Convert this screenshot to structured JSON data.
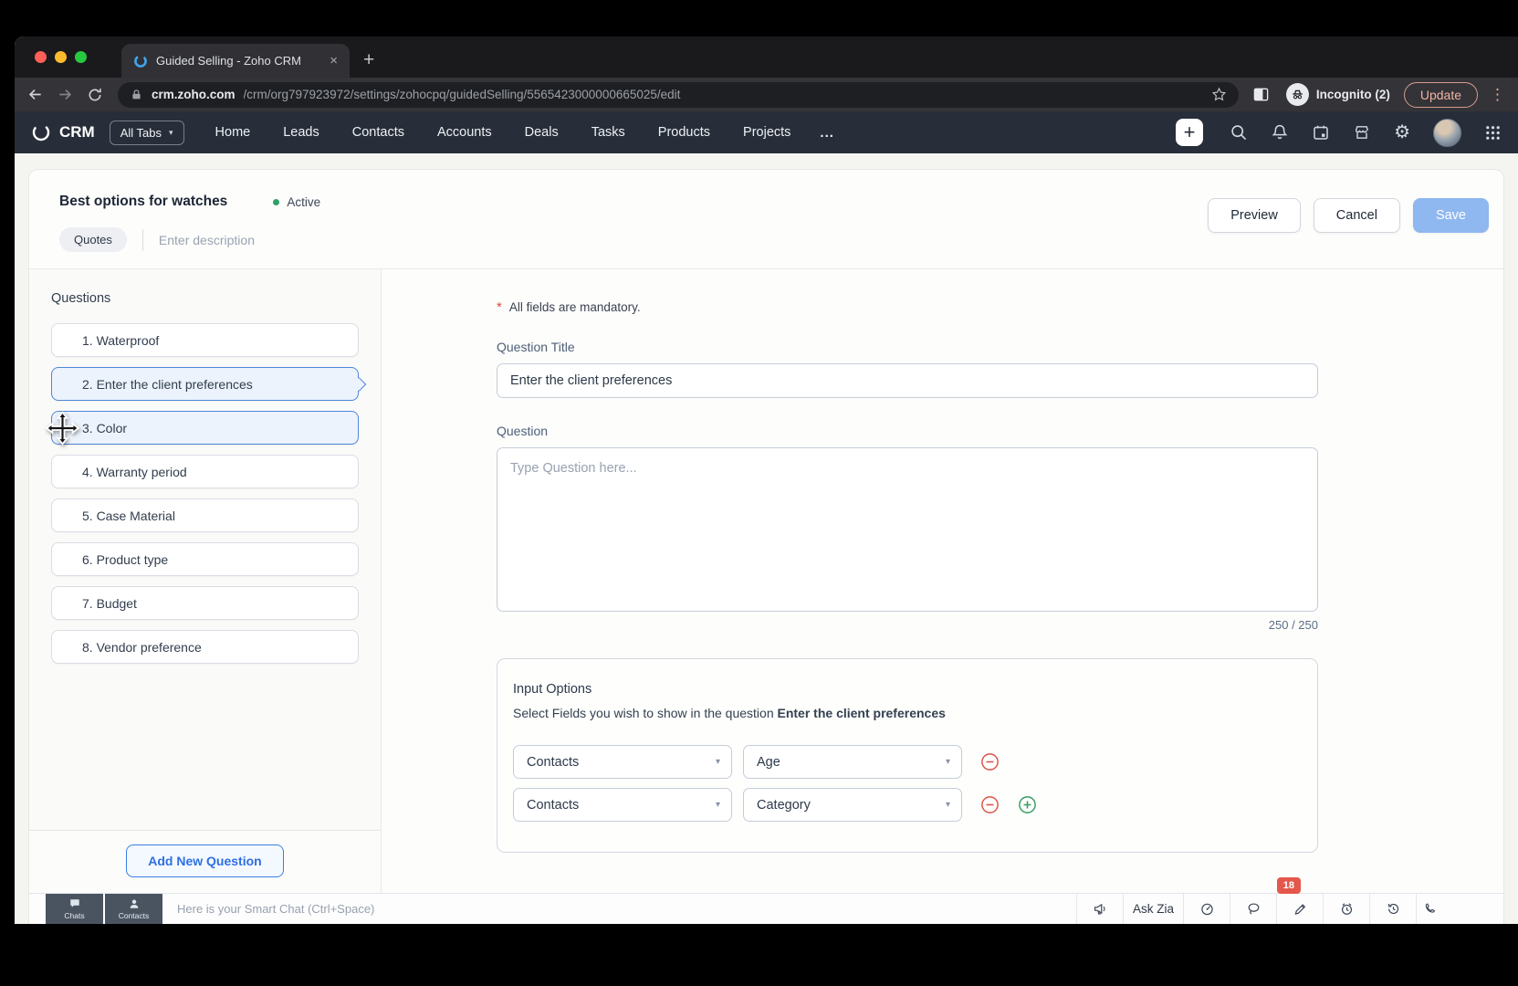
{
  "browser": {
    "tab_title": "Guided Selling - Zoho CRM",
    "url_host": "crm.zoho.com",
    "url_path": "/crm/org797923972/settings/zohocpq/guidedSelling/5565423000000665025/edit",
    "incognito_label": "Incognito (2)",
    "update_label": "Update"
  },
  "glyphs": {
    "close_tab": "×",
    "new_tab": "+",
    "kebab": "⋮",
    "caret_down": "▾",
    "gear": "⚙",
    "plus": "+"
  },
  "nav": {
    "brand": "CRM",
    "all_tabs_label": "All Tabs",
    "items": [
      "Home",
      "Leads",
      "Contacts",
      "Accounts",
      "Deals",
      "Tasks",
      "Products",
      "Projects"
    ],
    "more_label": "..."
  },
  "header": {
    "title": "Best options for watches",
    "status_label": "Active",
    "module_chip": "Quotes",
    "description_placeholder": "Enter description",
    "preview_label": "Preview",
    "cancel_label": "Cancel",
    "save_label": "Save"
  },
  "sidebar": {
    "heading": "Questions",
    "items": [
      {
        "label": "1. Waterproof",
        "state": "normal"
      },
      {
        "label": "2. Enter the client preferences",
        "state": "selected"
      },
      {
        "label": "3. Color",
        "state": "dragging"
      },
      {
        "label": "4. Warranty period",
        "state": "normal"
      },
      {
        "label": "5. Case Material",
        "state": "normal"
      },
      {
        "label": "6. Product type",
        "state": "normal"
      },
      {
        "label": "7. Budget",
        "state": "normal"
      },
      {
        "label": "8. Vendor preference",
        "state": "normal"
      }
    ],
    "add_button_label": "Add New Question"
  },
  "form": {
    "required_marker": "*",
    "mandatory_note": "All fields are mandatory.",
    "question_title_label": "Question Title",
    "question_title_value": "Enter the client preferences",
    "question_label": "Question",
    "question_placeholder": "Type Question here...",
    "char_counter": "250 / 250",
    "input_options": {
      "title": "Input Options",
      "subtitle_prefix": "Select Fields you wish to show in the question ",
      "subtitle_bold": "Enter the client preferences",
      "rows": [
        {
          "module": "Contacts",
          "field": "Age"
        },
        {
          "module": "Contacts",
          "field": "Category"
        }
      ]
    }
  },
  "footer": {
    "dock": [
      {
        "label": "Chats"
      },
      {
        "label": "Contacts"
      }
    ],
    "smart_chat_placeholder": "Here is your Smart Chat (Ctrl+Space)",
    "ask_zia_label": "Ask Zia",
    "notification_badge": "18"
  },
  "colors": {
    "accent_blue": "#4e86d9",
    "save_button_blue": "#8fb7f0",
    "status_green": "#2ea168",
    "badge_red": "#e4574b",
    "remove_red": "#dd5347",
    "add_green": "#359e5f"
  }
}
